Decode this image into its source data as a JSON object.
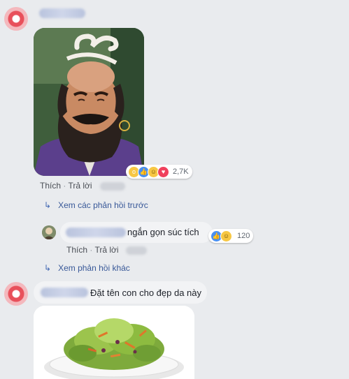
{
  "comment1": {
    "actions": {
      "like": "Thích",
      "sep": "·",
      "reply": "Trả lời"
    },
    "reaction_count": "2,7K",
    "reaction_icons": [
      "wow-icon",
      "like-icon",
      "haha-icon",
      "love-icon"
    ]
  },
  "view_prev_replies": "Xem các phản hồi trước",
  "reply1": {
    "text": "ngắn gọn súc tích",
    "reaction_count": "120",
    "reaction_icons": [
      "like-icon",
      "haha-icon"
    ],
    "actions": {
      "like": "Thích",
      "sep": "·",
      "reply": "Trả lời"
    }
  },
  "view_more_replies": "Xem phản hồi khác",
  "comment2": {
    "text": "Đặt tên con cho đẹp da này"
  },
  "colors": {
    "link": "#385898",
    "bg": "#e9ebee",
    "bubble": "#f2f3f5"
  }
}
